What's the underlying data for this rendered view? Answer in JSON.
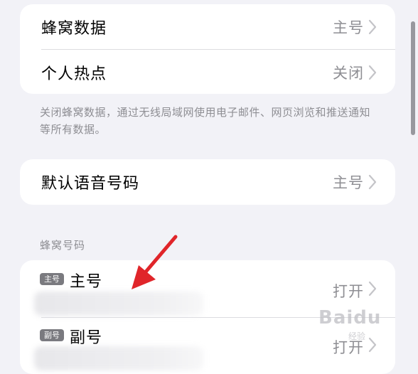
{
  "data_group": {
    "cellular_data": {
      "label": "蜂窝数据",
      "value": "主号"
    },
    "hotspot": {
      "label": "个人热点",
      "value": "关闭"
    }
  },
  "footnote": "关闭蜂窝数据，通过无线局域网使用电子邮件、网页浏览和推送通知等所有数据。",
  "voice_group": {
    "default_voice": {
      "label": "默认语音号码",
      "value": "主号"
    }
  },
  "numbers_section": {
    "header": "蜂窝号码",
    "lines": [
      {
        "badge": "主号",
        "label": "主号",
        "value": "打开"
      },
      {
        "badge": "副号",
        "label": "副号",
        "value": "打开"
      }
    ]
  },
  "watermark": {
    "text": "Baidu",
    "sub": "经验"
  },
  "colors": {
    "background": "#f2f2f7",
    "card": "#ffffff",
    "secondary_text": "#8e8e93",
    "annotation_arrow": "#e0252a"
  },
  "icons": {
    "chevron": "chevron-right-icon",
    "arrow": "red-arrow-annotation"
  }
}
